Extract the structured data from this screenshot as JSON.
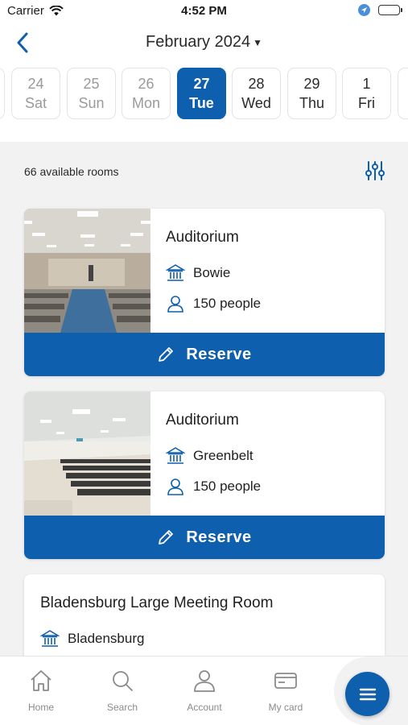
{
  "status_bar": {
    "carrier": "Carrier",
    "time": "4:52 PM",
    "icons": [
      "wifi-icon",
      "location-icon",
      "battery-icon"
    ]
  },
  "header": {
    "back_icon": "chevron-left-icon",
    "month_label": "February 2024",
    "month_chevron": "⌄"
  },
  "dates": [
    {
      "num": "24",
      "day": "Sat",
      "state": "past"
    },
    {
      "num": "25",
      "day": "Sun",
      "state": "past"
    },
    {
      "num": "26",
      "day": "Mon",
      "state": "past"
    },
    {
      "num": "27",
      "day": "Tue",
      "state": "selected"
    },
    {
      "num": "28",
      "day": "Wed",
      "state": "future"
    },
    {
      "num": "29",
      "day": "Thu",
      "state": "future"
    },
    {
      "num": "1",
      "day": "Fri",
      "state": "future"
    }
  ],
  "list": {
    "count_text": "66 available rooms",
    "filter_icon": "sliders-icon"
  },
  "rooms": [
    {
      "name": "Auditorium",
      "branch": "Bowie",
      "capacity": "150 people",
      "reserve_label": "Reserve"
    },
    {
      "name": "Auditorium",
      "branch": "Greenbelt",
      "capacity": "150 people",
      "reserve_label": "Reserve"
    },
    {
      "name": "Bladensburg Large Meeting Room",
      "branch": "Bladensburg"
    }
  ],
  "tabs": [
    {
      "label": "Home",
      "icon": "home-icon"
    },
    {
      "label": "Search",
      "icon": "search-icon"
    },
    {
      "label": "Account",
      "icon": "person-icon"
    },
    {
      "label": "My card",
      "icon": "card-icon"
    }
  ],
  "fab": {
    "icon": "menu-icon"
  },
  "colors": {
    "primary": "#0e5fad",
    "background": "#f2f2f2",
    "muted": "#8a8a8a"
  }
}
